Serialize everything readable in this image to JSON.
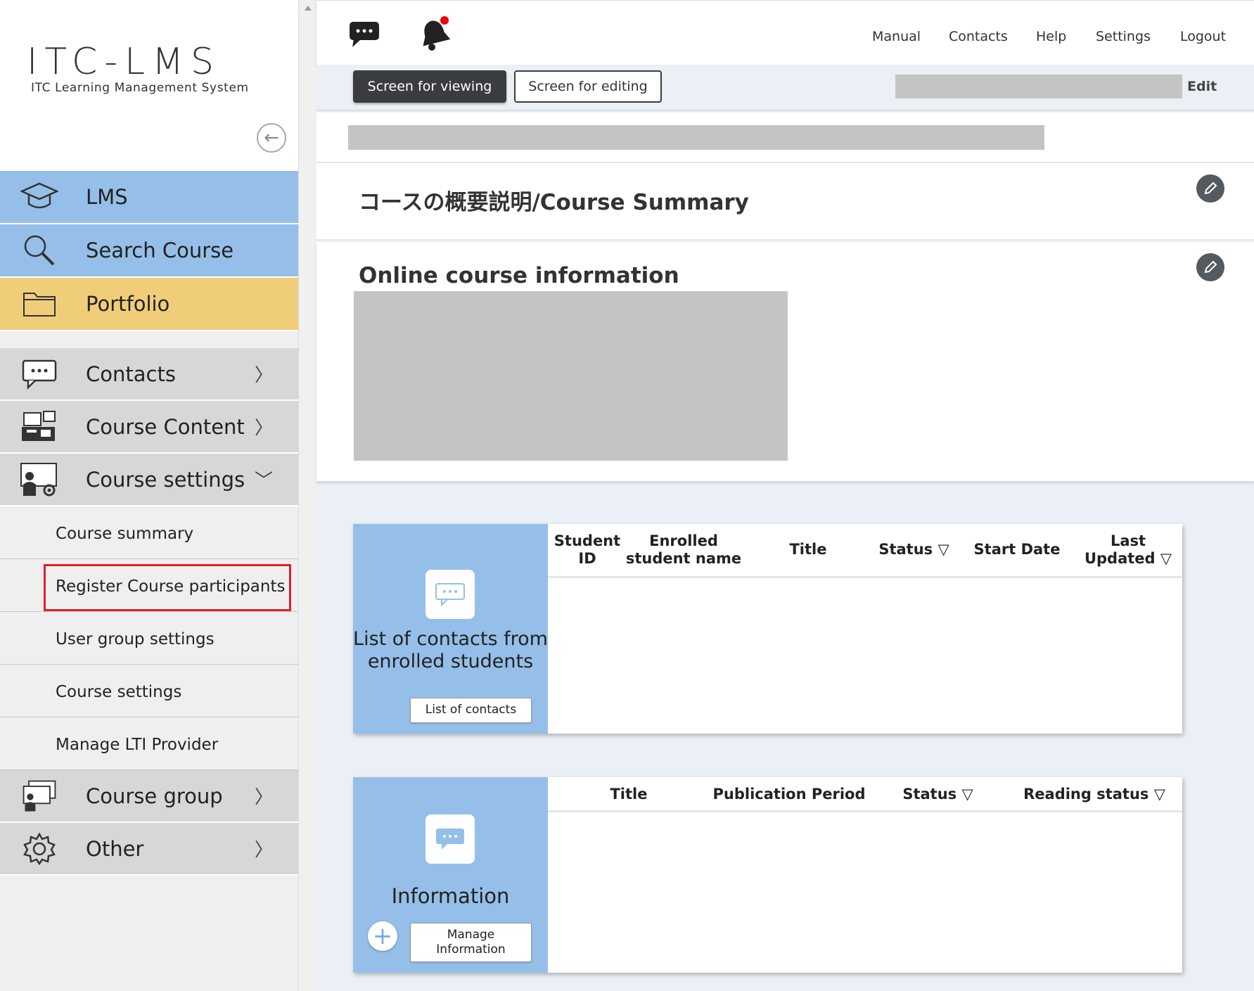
{
  "logo": {
    "title": "ITC-LMS",
    "subtitle": "ITC Learning Management System"
  },
  "sidebar": {
    "primary": [
      {
        "label": "LMS",
        "icon": "graduation-cap-icon"
      },
      {
        "label": "Search Course",
        "icon": "magnifier-icon"
      },
      {
        "label": "Portfolio",
        "icon": "folder-icon"
      }
    ],
    "menu": [
      {
        "label": "Contacts",
        "chevron": "〉"
      },
      {
        "label": "Course Content",
        "chevron": "〉"
      },
      {
        "label": "Course settings",
        "chevron": "﹀"
      }
    ],
    "submenu": [
      {
        "label": "Course summary"
      },
      {
        "label": "Register Course participants"
      },
      {
        "label": "User group settings"
      },
      {
        "label": "Course settings"
      },
      {
        "label": "Manage LTI Provider"
      }
    ],
    "menu2": [
      {
        "label": "Course group",
        "chevron": "〉"
      },
      {
        "label": "Other",
        "chevron": "〉"
      }
    ]
  },
  "topnav": {
    "links": [
      "Manual",
      "Contacts",
      "Help",
      "Settings",
      "Logout"
    ]
  },
  "modebar": {
    "view_label": "Screen for viewing",
    "edit_label": "Screen for editing",
    "edit_link": "Edit"
  },
  "sections": {
    "course_summary": "コースの概要説明/Course Summary",
    "online_info": "Online course information"
  },
  "contacts_card": {
    "title": "List of contacts from enrolled students",
    "button": "List of contacts",
    "columns": [
      "Student ID",
      "Enrolled student name",
      "Title",
      "Status ▽",
      "Start Date",
      "Last Updated ▽"
    ]
  },
  "info_card": {
    "title": "Information",
    "button": "Manage Information",
    "columns": [
      "Title",
      "Publication Period",
      "Status ▽",
      "Reading status ▽"
    ]
  },
  "colors": {
    "blue": "#95bfe8",
    "yellow": "#f0cd78",
    "gray": "#d5d7d9",
    "highlight": "#e0202a",
    "dark_button": "#3a3c40"
  }
}
